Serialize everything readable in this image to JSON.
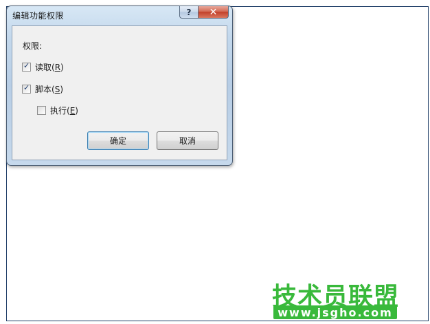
{
  "dialog": {
    "title": "编辑功能权限",
    "help_glyph": "?",
    "close_glyph": "✕",
    "permissions_label": "权限:",
    "checkboxes": [
      {
        "label": "读取(",
        "key": "R",
        "suffix": ")",
        "checked": true
      },
      {
        "label": "脚本(",
        "key": "S",
        "suffix": ")",
        "checked": true
      },
      {
        "label": "执行(",
        "key": "E",
        "suffix": ")",
        "checked": false
      }
    ],
    "ok_label": "确定",
    "cancel_label": "取消"
  },
  "watermark": {
    "text": "技术员联盟",
    "url": "www.jsgho.com"
  },
  "colors": {
    "watermark_green": "#39b93b",
    "close_red": "#c2402a",
    "default_button_border": "#3c7fb1"
  }
}
